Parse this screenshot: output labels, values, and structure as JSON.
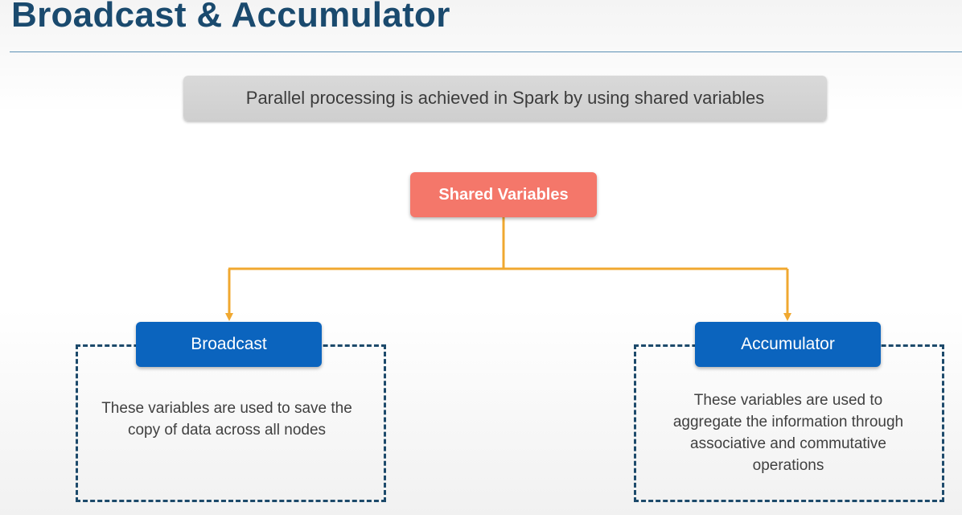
{
  "slide": {
    "title": "Broadcast & Accumulator",
    "banner_text": "Parallel processing is achieved in Spark by using shared variables"
  },
  "diagram": {
    "root": {
      "label": "Shared Variables"
    },
    "children": [
      {
        "label": "Broadcast",
        "description": "These variables are used to save the copy of data across all nodes"
      },
      {
        "label": "Accumulator",
        "description": "These variables are used to aggregate the information through associative and commutative operations"
      }
    ]
  },
  "colors": {
    "title": "#1a4a6e",
    "root_box": "#f4776a",
    "child_box": "#0b64be",
    "connector": "#f0a830",
    "dashed_frame": "#1d4a6b",
    "banner": "#d3d3d3"
  }
}
